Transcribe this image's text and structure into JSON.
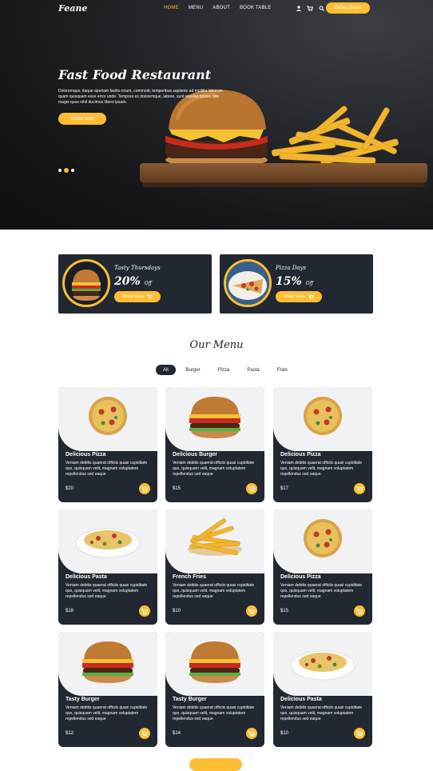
{
  "brand": "Feane",
  "nav": {
    "links": [
      "HOME",
      "MENU",
      "ABOUT",
      "BOOK TABLE"
    ],
    "icons": [
      "user-icon",
      "cart-icon",
      "search-icon"
    ],
    "order_online": "Order Online"
  },
  "hero": {
    "title": "Fast Food Restaurant",
    "text": "Doloremque, itaque aperiam facilis rerum, commodi, temporibus sapiente ad mollitia laborum quam quisquam esse error unde. Tempora ex doloremque, labore, sunt repellat dolore, iste magni quos nihil ducimus libero ipsam.",
    "button": "Order Now",
    "slides": 3,
    "active_slide": 2
  },
  "offers": [
    {
      "title": "Tasty Thursdays",
      "percent": "20%",
      "suffix": "Off",
      "button": "Order Now"
    },
    {
      "title": "Pizza Days",
      "percent": "15%",
      "suffix": "Off",
      "button": "Order Now"
    }
  ],
  "menu": {
    "heading": "Our Menu",
    "filters": [
      "All",
      "Burger",
      "Pizza",
      "Pasta",
      "Fries"
    ],
    "active_filter": "All",
    "items": [
      {
        "name": "Delicious Pizza",
        "desc": "Veniam debitis quaerat officiis quasi cupiditate quo, quisquam velit, magnam voluptatem repellendus sed eaque",
        "price": "$20",
        "icon": "pizza-icon"
      },
      {
        "name": "Delicious Burger",
        "desc": "Veniam debitis quaerat officiis quasi cupiditate quo, quisquam velit, magnam voluptatem repellendus sed eaque",
        "price": "$15",
        "icon": "burger-icon"
      },
      {
        "name": "Delicious Pizza",
        "desc": "Veniam debitis quaerat officiis quasi cupiditate quo, quisquam velit, magnam voluptatem repellendus sed eaque",
        "price": "$17",
        "icon": "pizza-icon"
      },
      {
        "name": "Delicious Pasta",
        "desc": "Veniam debitis quaerat officiis quasi cupiditate quo, quisquam velit, magnam voluptatem repellendus sed eaque",
        "price": "$18",
        "icon": "pasta-icon"
      },
      {
        "name": "French Fries",
        "desc": "Veniam debitis quaerat officiis quasi cupiditate quo, quisquam velit, magnam voluptatem repellendus sed eaque",
        "price": "$10",
        "icon": "fries-icon"
      },
      {
        "name": "Delicious Pizza",
        "desc": "Veniam debitis quaerat officiis quasi cupiditate quo, quisquam velit, magnam voluptatem repellendus sed eaque",
        "price": "$15",
        "icon": "pizza-icon"
      },
      {
        "name": "Tasty Burger",
        "desc": "Veniam debitis quaerat officiis quasi cupiditate quo, quisquam velit, magnam voluptatem repellendus sed eaque",
        "price": "$12",
        "icon": "burger-icon"
      },
      {
        "name": "Tasty Burger",
        "desc": "Veniam debitis quaerat officiis quasi cupiditate quo, quisquam velit, magnam voluptatem repellendus sed eaque",
        "price": "$14",
        "icon": "burger-icon"
      },
      {
        "name": "Delicious Pasta",
        "desc": "Veniam debitis quaerat officiis quasi cupiditate quo, quisquam velit, magnam voluptatem repellendus sed eaque",
        "price": "$10",
        "icon": "pasta-icon"
      }
    ]
  },
  "colors": {
    "accent": "#ffbe33",
    "dark": "#222831",
    "card_top": "#f1f2f3"
  }
}
